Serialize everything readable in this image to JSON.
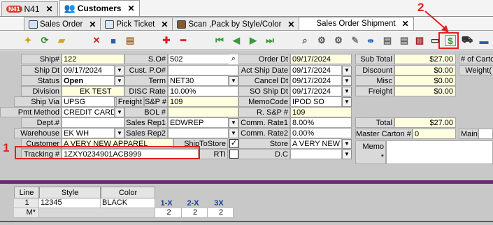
{
  "top_tabs": [
    {
      "label": "N41",
      "badge": "N41"
    },
    {
      "label": "Customers"
    }
  ],
  "sub_tabs": [
    {
      "label": "Sales Order"
    },
    {
      "label": "Pick Ticket"
    },
    {
      "label": "Scan ,Pack by Style/Color"
    },
    {
      "label": "Sales Order Shipment"
    }
  ],
  "toolbar_icons": [
    "new-icon",
    "refresh-icon",
    "open-icon",
    "delete-icon",
    "save-icon",
    "print-icon",
    "add-icon",
    "remove-icon",
    "first-icon",
    "prev-icon",
    "next-icon",
    "last-icon",
    "search-icon",
    "gear-icon",
    "gear-icon",
    "note-icon",
    "split-icon",
    "print-icon",
    "print-icon",
    "barcode-icon",
    "window-icon",
    "dollar-icon",
    "truck-icon",
    "card-icon"
  ],
  "annotations": {
    "one": "1",
    "two": "2"
  },
  "fields": {
    "ship_no": {
      "label": "Ship#",
      "value": "122"
    },
    "so_no": {
      "label": "S.O#",
      "value": "502"
    },
    "order_dt": {
      "label": "Order Dt",
      "value": "09/17/2024"
    },
    "ship_dt": {
      "label": "Ship Dt",
      "value": "09/17/2024"
    },
    "cust_po": {
      "label": "Cust. P.O#",
      "value": ""
    },
    "act_ship_date": {
      "label": "Act Ship Date",
      "value": "09/17/2024"
    },
    "status": {
      "label": "Status",
      "value": "Open"
    },
    "term": {
      "label": "Term",
      "value": "NET30"
    },
    "cancel_dt": {
      "label": "Cancel Dt",
      "value": "09/17/2024"
    },
    "division": {
      "label": "Division",
      "value": "EK TEST"
    },
    "disc_rate": {
      "label": "DISC Rate",
      "value": "10.00%"
    },
    "so_ship_dt": {
      "label": "SO Ship Dt",
      "value": "09/17/2024"
    },
    "ship_via": {
      "label": "Ship Via",
      "value": "UPSG"
    },
    "freight_flag": {
      "label": "Freight"
    },
    "sp_no": {
      "label": "S&P #",
      "value": "109"
    },
    "memo_code": {
      "label": "MemoCode",
      "value": "IPOD SO"
    },
    "pmt_method": {
      "label": "Pmt Method",
      "value": "CREDIT CARD"
    },
    "bol": {
      "label": "BOL #",
      "value": ""
    },
    "r_sp": {
      "label": "R. S&P #",
      "value": "109"
    },
    "dept": {
      "label": "Dept.#",
      "value": ""
    },
    "sales_rep1": {
      "label": "Sales Rep1",
      "value": "EDWREP"
    },
    "comm_rate1": {
      "label": "Comm. Rate1",
      "value": "8.00%"
    },
    "warehouse": {
      "label": "Warehouse",
      "value": "EK WH"
    },
    "sales_rep2": {
      "label": "Sales Rep2",
      "value": ""
    },
    "comm_rate2": {
      "label": "Comm. Rate2",
      "value": "0.00%"
    },
    "customer": {
      "label": "Customer",
      "value": "A VERY NEW APPAREL"
    },
    "ship_to_store": {
      "label": "ShipToStore"
    },
    "store": {
      "label": "Store",
      "value": "A VERY NEW A"
    },
    "tracking": {
      "label": "Tracking #",
      "value": "1ZXY0234901ACB999"
    },
    "rti": {
      "label": "RTI"
    },
    "dc": {
      "label": "D.C",
      "value": ""
    }
  },
  "totals": {
    "sub_total": {
      "label": "Sub Total",
      "value": "$27.00"
    },
    "discount": {
      "label": "Discount",
      "value": "$0.00"
    },
    "misc": {
      "label": "Misc",
      "value": "$0.00"
    },
    "freight": {
      "label": "Freight",
      "value": "$0.00"
    },
    "total": {
      "label": "Total",
      "value": "$27.00"
    },
    "master_carton": {
      "label": "Master Carton #",
      "value": "0"
    },
    "main": {
      "label": "Main"
    },
    "memo": {
      "label": "Memo",
      "star": "*"
    },
    "num_cartons": {
      "label": "# of Carto"
    },
    "weight": {
      "label": "Weight("
    }
  },
  "grid": {
    "headers": [
      "Line",
      "Style",
      "Color"
    ],
    "size_labels": [
      "1-X",
      "2-X",
      "3X"
    ],
    "rows": [
      {
        "line": "1",
        "style": "12345",
        "color": "BLACK",
        "sizes": [
          "2",
          "2",
          "2"
        ]
      }
    ],
    "new_row_marker": "M*"
  }
}
